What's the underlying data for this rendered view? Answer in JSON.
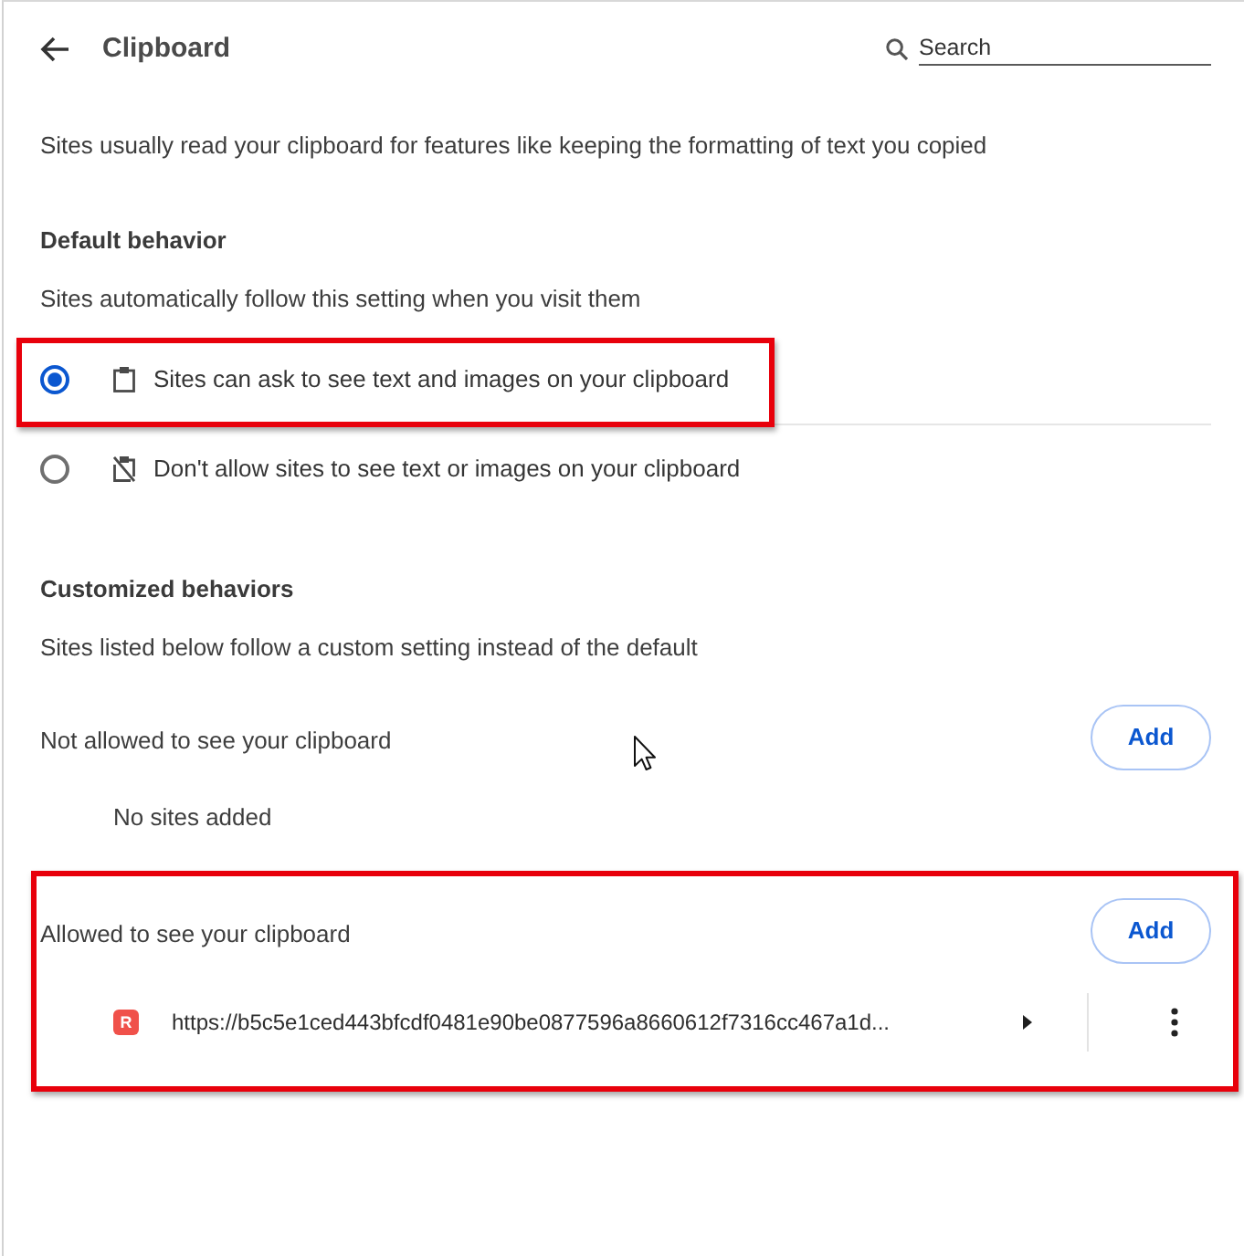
{
  "header": {
    "title": "Clipboard",
    "search": {
      "placeholder": "Search"
    }
  },
  "description": "Sites usually read your clipboard for features like keeping the formatting of text you copied",
  "default_behavior": {
    "heading": "Default behavior",
    "subtitle": "Sites automatically follow this setting when you visit them",
    "options": [
      {
        "kind": "allow",
        "label": "Sites can ask to see text and images on your clipboard",
        "selected": true,
        "highlighted": true
      },
      {
        "kind": "block",
        "label": "Don't allow sites to see text or images on your clipboard",
        "selected": false,
        "highlighted": false
      }
    ]
  },
  "customized_behaviors": {
    "heading": "Customized behaviors",
    "subtitle": "Sites listed below follow a custom setting instead of the default",
    "lists": [
      {
        "title": "Not allowed to see your clipboard",
        "add_button": "Add",
        "empty_text": "No sites added",
        "highlighted": false
      },
      {
        "title": "Allowed to see your clipboard",
        "add_button": "Add",
        "highlighted": true,
        "sites": [
          {
            "favicon": "R",
            "url": "https://b5c5e1ced443bfcdf0481e90be0877596a8660612f7316cc467a1d..."
          }
        ]
      }
    ]
  }
}
